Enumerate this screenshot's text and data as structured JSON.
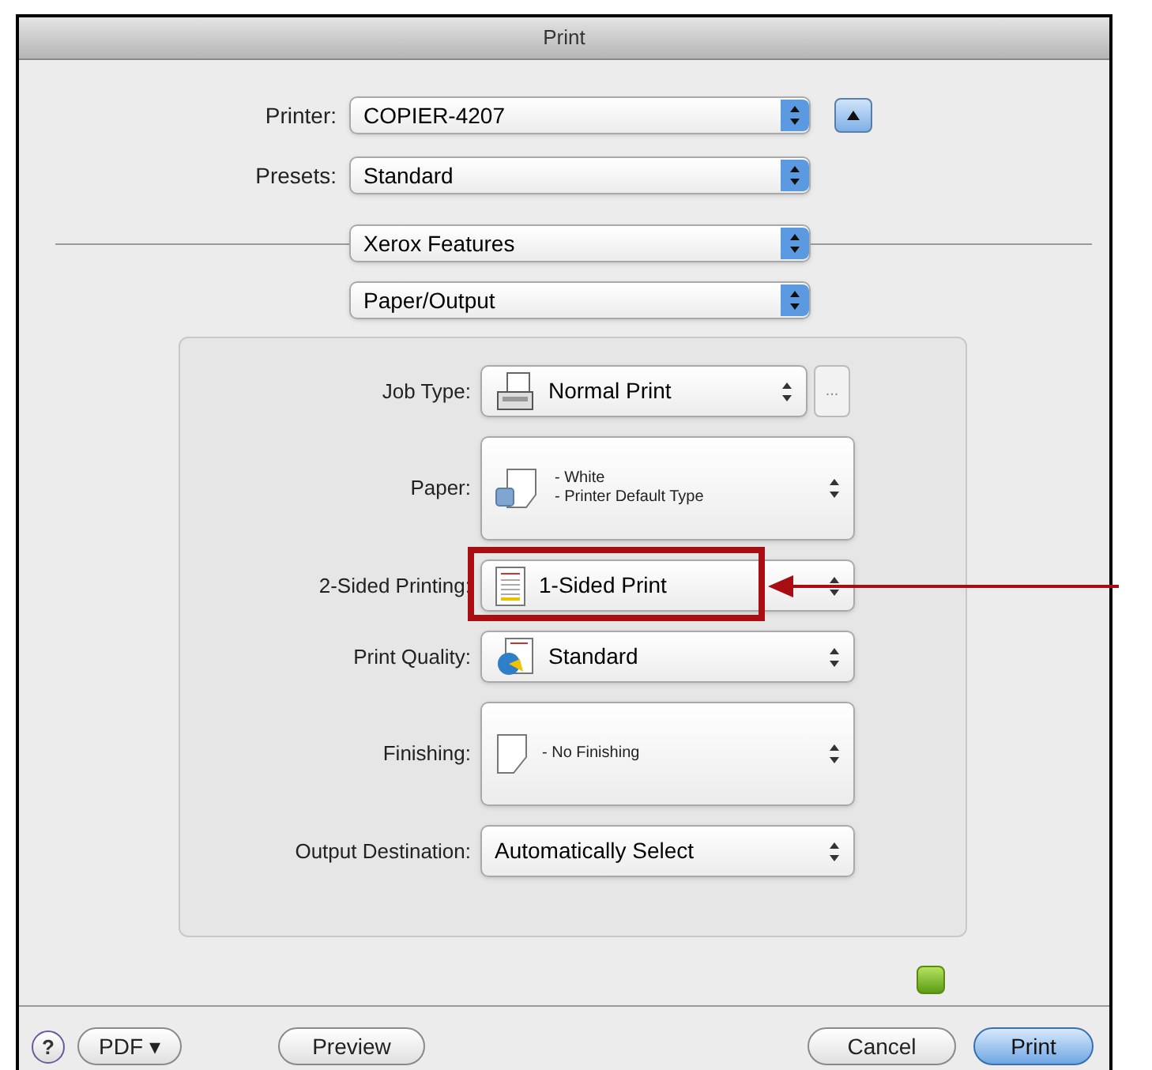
{
  "window": {
    "title": "Print"
  },
  "printer": {
    "label": "Printer:",
    "value": "COPIER-4207"
  },
  "presets": {
    "label": "Presets:",
    "value": "Standard"
  },
  "feature_set": {
    "value": "Xerox Features"
  },
  "panel_menu": {
    "value": "Paper/Output"
  },
  "options": [
    {
      "kind": "single",
      "label": "Job Type:",
      "value": "Normal Print",
      "more": "...",
      "highlighted": false
    },
    {
      "kind": "lines",
      "label": "Paper:",
      "lines": [
        "- White",
        "- Printer Default Type"
      ],
      "highlighted": false
    },
    {
      "kind": "single",
      "label": "2-Sided Printing:",
      "value": "1-Sided Print",
      "highlighted": true
    },
    {
      "kind": "single",
      "label": "Print Quality:",
      "value": "Standard",
      "highlighted": false
    },
    {
      "kind": "lines",
      "label": "Finishing:",
      "lines": [
        "- No Finishing"
      ],
      "highlighted": false
    },
    {
      "kind": "plain",
      "label": "Output Destination:",
      "value": "Automatically Select",
      "highlighted": false
    }
  ],
  "buttons": {
    "help": "?",
    "pdf": "PDF ▾",
    "preview": "Preview",
    "cancel": "Cancel",
    "print": "Print"
  }
}
